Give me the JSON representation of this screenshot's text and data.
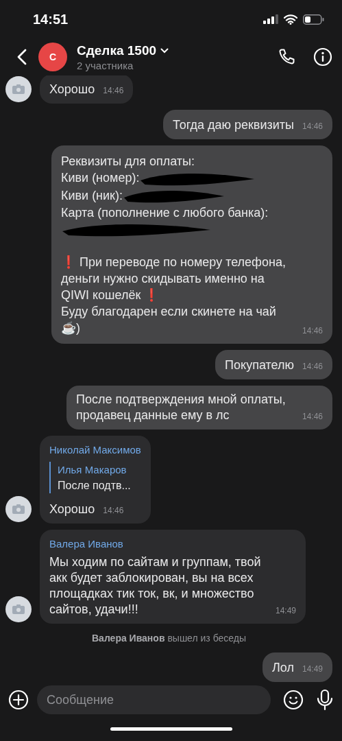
{
  "status_bar": {
    "time": "14:51"
  },
  "header": {
    "avatar_letter": "С",
    "title": "Сделка 1500",
    "subtitle": "2 участника"
  },
  "messages": [
    {
      "kind": "incoming",
      "avatar": true,
      "text": "Хорошо",
      "time": "14:46"
    },
    {
      "kind": "outgoing",
      "text": "Тогда даю реквизиты",
      "time": "14:46"
    },
    {
      "kind": "outgoing",
      "lines": [
        {
          "kind": "text",
          "text": "Реквизиты для оплаты:"
        },
        {
          "kind": "redacted",
          "text": "Киви (номер):"
        },
        {
          "kind": "redacted",
          "text": "Киви (ник):"
        },
        {
          "kind": "text",
          "text": "Карта (пополнение с любого банка):"
        },
        {
          "kind": "redacted_line"
        },
        {
          "kind": "gap"
        },
        {
          "kind": "rich",
          "parts": [
            {
              "kind": "alert",
              "text": "❗"
            },
            {
              "kind": "text",
              "text": " При переводе по номеру телефона, деньги нужно скидывать именно на QIWI кошелёк "
            },
            {
              "kind": "alert",
              "text": "❗"
            }
          ]
        },
        {
          "kind": "rich",
          "parts": [
            {
              "kind": "text",
              "text": "Буду благодарен если скинете на чай "
            },
            {
              "kind": "emoji",
              "text": "☕"
            },
            {
              "kind": "text",
              "text": ")"
            }
          ]
        }
      ],
      "time": "14:46"
    },
    {
      "kind": "outgoing",
      "text": "Покупателю",
      "time": "14:46"
    },
    {
      "kind": "outgoing",
      "text": "После подтверждения мной оплаты, продавец данные ему в лс",
      "time": "14:46"
    },
    {
      "kind": "incoming",
      "avatar": true,
      "sender": "Николай Максимов",
      "reply": {
        "author": "Илья Макаров",
        "text": "После подтв..."
      },
      "text": "Хорошо",
      "time": "14:46"
    },
    {
      "kind": "incoming",
      "avatar": true,
      "sender": "Валера Иванов",
      "text": "Мы ходим по сайтам и группам, твой акк будет заблокирован,  вы на всех площадках тик ток, вк, и множество сайтов, удачи!!!",
      "time": "14:49"
    },
    {
      "kind": "system",
      "actor": "Валера Иванов",
      "text": "вышел из беседы"
    },
    {
      "kind": "outgoing",
      "text": "Лол",
      "time": "14:49"
    }
  ],
  "composer": {
    "placeholder": "Сообщение"
  }
}
